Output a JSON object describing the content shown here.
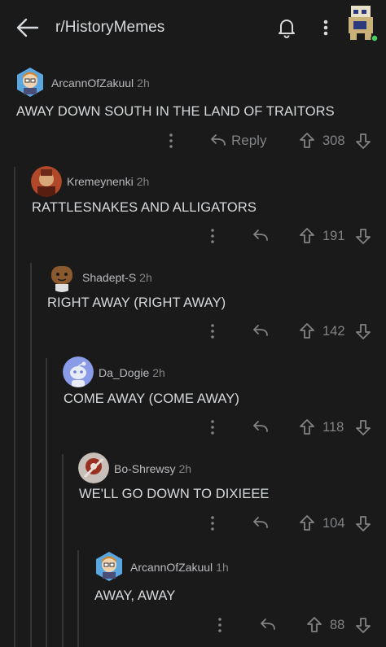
{
  "header": {
    "subreddit": "r/HistoryMemes",
    "back_icon": "back-arrow-icon",
    "bell_icon": "bell-icon",
    "more_icon": "kebab-menu-icon"
  },
  "comments": [
    {
      "author": "ArcannOfZakuul",
      "time": "2h",
      "text": "AWAY DOWN SOUTH IN THE LAND OF TRAITORS",
      "reply_label": "Reply",
      "score": "308"
    },
    {
      "author": "Kremeynenki",
      "time": "2h",
      "text": "RATTLESNAKES AND ALLIGATORS",
      "score": "191"
    },
    {
      "author": "Shadept-S",
      "time": "2h",
      "text": "RIGHT AWAY (RIGHT AWAY)",
      "score": "142"
    },
    {
      "author": "Da_Dogie",
      "time": "2h",
      "text": "COME AWAY (COME AWAY)",
      "score": "118"
    },
    {
      "author": "Bo-Shrewsy",
      "time": "2h",
      "text": "WE'LL GO DOWN TO DIXIEEE",
      "score": "104"
    },
    {
      "author": "ArcannOfZakuul",
      "time": "1h",
      "text": "AWAY, AWAY",
      "score": "88"
    }
  ],
  "colors": {
    "background": "#1a1a1b",
    "text": "#d7dadc",
    "muted": "#818384",
    "thread_line": "#343536",
    "online_dot": "#46d160"
  }
}
